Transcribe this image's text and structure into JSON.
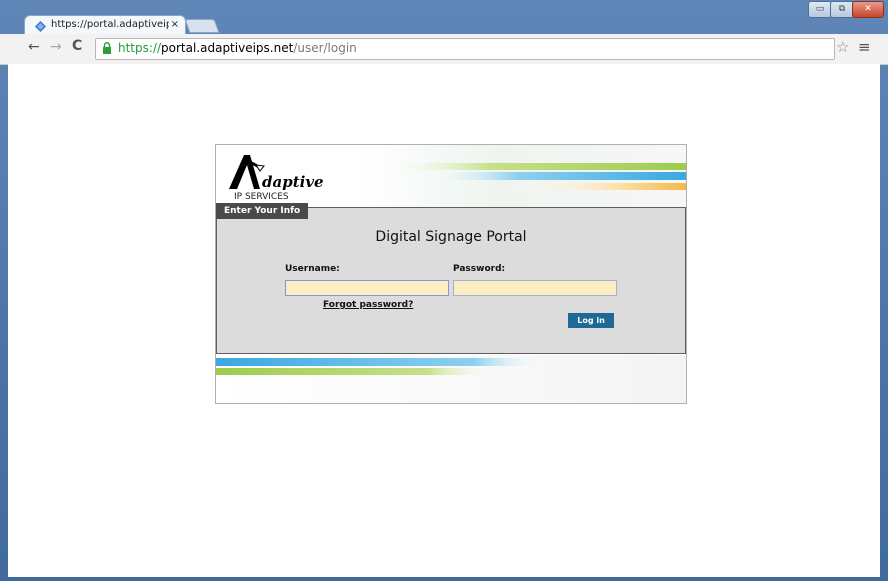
{
  "browser": {
    "tab_title": "https://portal.adaptiveips",
    "tab_close": "×",
    "url_secure": "https://",
    "url_host": "portal.adaptiveips.net",
    "url_path": "/user/login",
    "back_glyph": "←",
    "forward_glyph": "→",
    "reload_glyph": "C",
    "star_glyph": "☆",
    "menu_glyph": "≡",
    "window_controls": {
      "minimize": "▭",
      "restore": "⧉",
      "close": "✕"
    }
  },
  "logo": {
    "name": "daptive",
    "tagline": "IP SERVICES"
  },
  "form": {
    "section_tab": "Enter Your Info",
    "heading": "Digital Signage Portal",
    "username_label": "Username:",
    "username_value": "",
    "password_label": "Password:",
    "password_value": "",
    "forgot_link": "Forgot password?",
    "login_button": "Log in"
  },
  "colors": {
    "field_fill": "#fbeec2",
    "button": "#1c6a95",
    "form_bg": "#dcdcdc"
  }
}
